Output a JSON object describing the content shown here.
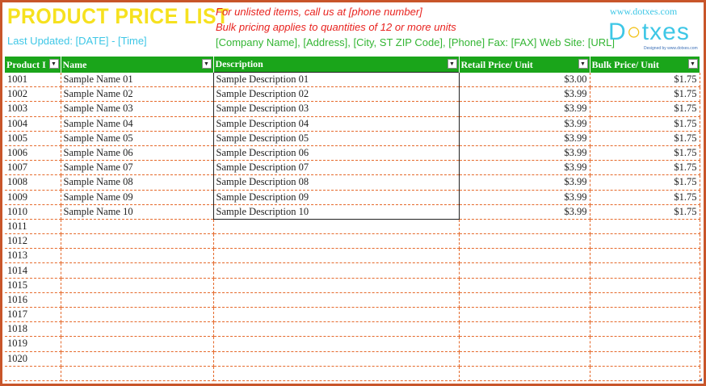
{
  "header": {
    "title": "PRODUCT PRICE LIST",
    "last_updated": "Last Updated: [DATE] - [Time]",
    "note_line1": "For unlisted items, call us at [phone number]",
    "note_line2": "Bulk pricing applies to quantities of 12 or more units",
    "company_line": "[Company Name], [Address], [City, ST  ZIP Code], [Phone] Fax: [FAX] Web Site: [URL]",
    "website": "www.dotxes.com",
    "logo_text_a": "D",
    "logo_text_b": "txes",
    "logo_tagline": "Designed by www.dotxes.com"
  },
  "colors": {
    "frame": "#c8552a",
    "title": "#f6e11f",
    "header_row": "#1aa51a",
    "note": "#e8221e",
    "company": "#33b533",
    "accent": "#3ec7e6"
  },
  "table": {
    "columns": [
      {
        "label": "Product ID"
      },
      {
        "label": "Name"
      },
      {
        "label": "Description"
      },
      {
        "label": "Retail Price/ Unit"
      },
      {
        "label": "Bulk Price/ Unit"
      }
    ],
    "dropdown_icon": "dropdown-arrow-icon",
    "rows": [
      {
        "id": "1001",
        "name": "Sample Name 01",
        "desc": "Sample Description 01",
        "retail": "$3.00",
        "bulk": "$1.75"
      },
      {
        "id": "1002",
        "name": "Sample Name 02",
        "desc": "Sample Description 02",
        "retail": "$3.99",
        "bulk": "$1.75"
      },
      {
        "id": "1003",
        "name": "Sample Name 03",
        "desc": "Sample Description 03",
        "retail": "$3.99",
        "bulk": "$1.75"
      },
      {
        "id": "1004",
        "name": "Sample Name 04",
        "desc": "Sample Description 04",
        "retail": "$3.99",
        "bulk": "$1.75"
      },
      {
        "id": "1005",
        "name": "Sample Name 05",
        "desc": "Sample Description 05",
        "retail": "$3.99",
        "bulk": "$1.75"
      },
      {
        "id": "1006",
        "name": "Sample Name 06",
        "desc": "Sample Description 06",
        "retail": "$3.99",
        "bulk": "$1.75"
      },
      {
        "id": "1007",
        "name": "Sample Name 07",
        "desc": "Sample Description 07",
        "retail": "$3.99",
        "bulk": "$1.75"
      },
      {
        "id": "1008",
        "name": "Sample Name 08",
        "desc": "Sample Description 08",
        "retail": "$3.99",
        "bulk": "$1.75"
      },
      {
        "id": "1009",
        "name": "Sample Name 09",
        "desc": "Sample Description 09",
        "retail": "$3.99",
        "bulk": "$1.75"
      },
      {
        "id": "1010",
        "name": "Sample Name 10",
        "desc": "Sample Description 10",
        "retail": "$3.99",
        "bulk": "$1.75"
      },
      {
        "id": "1011",
        "name": "",
        "desc": "",
        "retail": "",
        "bulk": ""
      },
      {
        "id": "1012",
        "name": "",
        "desc": "",
        "retail": "",
        "bulk": ""
      },
      {
        "id": "1013",
        "name": "",
        "desc": "",
        "retail": "",
        "bulk": ""
      },
      {
        "id": "1014",
        "name": "",
        "desc": "",
        "retail": "",
        "bulk": ""
      },
      {
        "id": "1015",
        "name": "",
        "desc": "",
        "retail": "",
        "bulk": ""
      },
      {
        "id": "1016",
        "name": "",
        "desc": "",
        "retail": "",
        "bulk": ""
      },
      {
        "id": "1017",
        "name": "",
        "desc": "",
        "retail": "",
        "bulk": ""
      },
      {
        "id": "1018",
        "name": "",
        "desc": "",
        "retail": "",
        "bulk": ""
      },
      {
        "id": "1019",
        "name": "",
        "desc": "",
        "retail": "",
        "bulk": ""
      },
      {
        "id": "1020",
        "name": "",
        "desc": "",
        "retail": "",
        "bulk": ""
      },
      {
        "id": "",
        "name": "",
        "desc": "",
        "retail": "",
        "bulk": ""
      }
    ]
  }
}
